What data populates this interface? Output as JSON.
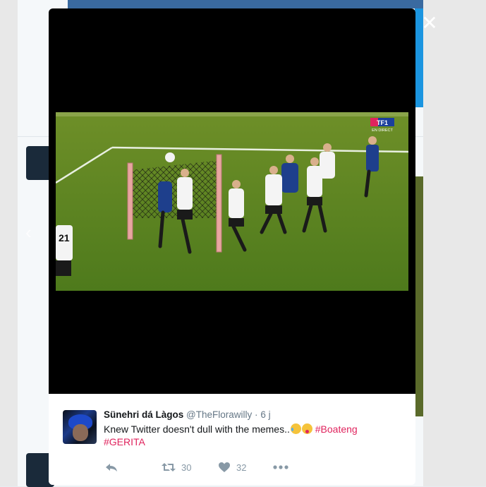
{
  "close": {
    "glyph": "✕"
  },
  "navigation": {
    "prev_glyph": "‹"
  },
  "tweet": {
    "display_name": "Sünehri dá Làgos",
    "handle": "@TheFlorawilly",
    "separator": "·",
    "time": "6 j",
    "text": "Knew Twitter doesn't dull with the memes..",
    "emojis": [
      "face-with-tears-of-joy",
      "squinting-face-with-tongue"
    ],
    "hashtags": [
      "#Boateng",
      "#GERITA"
    ]
  },
  "actions": {
    "reply_icon": "reply-icon",
    "retweet_icon": "retweet-icon",
    "retweet_count": "30",
    "like_icon": "heart-icon",
    "like_count": "32",
    "more_icon": "more-icon"
  },
  "broadcast": {
    "channel": "TF1",
    "subtitle": "EN DIRECT"
  },
  "colors": {
    "hashtag": "#e0245e",
    "muted": "#657786",
    "icon": "#8899a6"
  }
}
